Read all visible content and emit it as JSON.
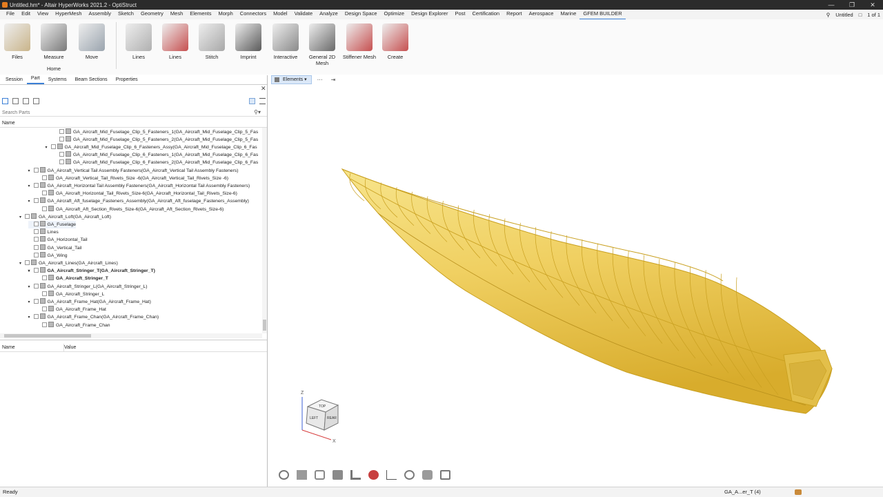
{
  "window": {
    "title": "Untitled.hm* - Altair HyperWorks 2021.2 - OptiStruct"
  },
  "menubar": {
    "items": [
      "File",
      "Edit",
      "View",
      "HyperMesh",
      "Assembly",
      "Sketch",
      "Geometry",
      "Mesh",
      "Elements",
      "Morph",
      "Connectors",
      "Model",
      "Validate",
      "Analyze",
      "Design Space",
      "Optimize",
      "Design Explorer",
      "Post",
      "Certification",
      "Report",
      "Aerospace",
      "Marine",
      "GFEM BUILDER"
    ],
    "active": "GFEM BUILDER",
    "session_label": "Untitled",
    "page_indicator": "1 of 1"
  },
  "ribbon": {
    "group_label": "Home",
    "tools": [
      {
        "label": "Files",
        "icon": "files-icon"
      },
      {
        "label": "Measure",
        "icon": "measure-icon"
      },
      {
        "label": "Move",
        "icon": "move-icon"
      },
      {
        "label": "Lines",
        "icon": "lines-grid-icon"
      },
      {
        "label": "Lines",
        "icon": "lines-icon"
      },
      {
        "label": "Stitch",
        "icon": "stitch-icon"
      },
      {
        "label": "Imprint",
        "icon": "imprint-icon"
      },
      {
        "label": "Interactive",
        "icon": "interactive-icon"
      },
      {
        "label": "General 2D Mesh",
        "icon": "mesh-2d-icon"
      },
      {
        "label": "Stiffener Mesh",
        "icon": "stiffener-mesh-icon"
      },
      {
        "label": "Create",
        "icon": "create-icon"
      }
    ]
  },
  "panel": {
    "tabs": [
      "Session",
      "Part",
      "Systems",
      "Beam Sections",
      "Properties"
    ],
    "active_tab": "Part",
    "search_placeholder": "Search Parts",
    "tree_header": "Name",
    "tree": [
      {
        "label": "GA_Aircraft_Mid_Fuselage_Clip_5_Fasteners_1(GA_Aircraft_Mid_Fuselage_Clip_5_Fas",
        "level": 5,
        "expander": ""
      },
      {
        "label": "GA_Aircraft_Mid_Fuselage_Clip_5_Fasteners_2(GA_Aircraft_Mid_Fuselage_Clip_5_Fas",
        "level": 5,
        "expander": ""
      },
      {
        "label": "GA_Aircraft_Mid_Fuselage_Clip_6_Fasteners_Assy(GA_Aircraft_Mid_Fuselage_Clip_6_Fas",
        "level": 4,
        "expander": "▾"
      },
      {
        "label": "GA_Aircraft_Mid_Fuselage_Clip_6_Fasteners_1(GA_Aircraft_Mid_Fuselage_Clip_6_Fas",
        "level": 5,
        "expander": ""
      },
      {
        "label": "GA_Aircraft_Mid_Fuselage_Clip_6_Fasteners_2(GA_Aircraft_Mid_Fuselage_Clip_6_Fas",
        "level": 5,
        "expander": ""
      },
      {
        "label": "GA_Aircraft_Vertical Tail Assembly Fasteners(GA_Aircraft_Vertical Tail Assembly Fasteners)",
        "level": 2,
        "expander": "▾"
      },
      {
        "label": "GA_Aircraft_Vertical_Tail_Rivets_Size -6(GA_Aircraft_Vertical_Tail_Rivets_Size -6)",
        "level": 3,
        "expander": ""
      },
      {
        "label": "GA_Aircraft_Horizontal Tail Assembly Fasteners(GA_Aircraft_Horizontal Tail Assembly Fasteners)",
        "level": 2,
        "expander": "▾"
      },
      {
        "label": "GA_Aircraft_Horizontal_Tail_Rivets_Size-6(GA_Aircraft_Horizontal_Tail_Rivets_Size-6)",
        "level": 3,
        "expander": ""
      },
      {
        "label": "GA_Aircraft_Aft_fuselage_Fasteners_Assembly(GA_Aircraft_Aft_fuselage_Fasteners_Assembly)",
        "level": 2,
        "expander": "▾"
      },
      {
        "label": "GA_Aircraft_Aft_Section_Rivets_Size-6(GA_Aircraft_Aft_Section_Rivets_Size-6)",
        "level": 3,
        "expander": ""
      },
      {
        "label": "GA_Aircraft_Loft(GA_Aircraft_Loft)",
        "level": 1,
        "expander": "▾"
      },
      {
        "label": "GA_Fuselage",
        "level": 2,
        "expander": ""
      },
      {
        "label": "Lines",
        "level": 2,
        "expander": ""
      },
      {
        "label": "GA_Horizontal_Tail",
        "level": 2,
        "expander": ""
      },
      {
        "label": "GA_Vertical_Tail",
        "level": 2,
        "expander": ""
      },
      {
        "label": "GA_Wing",
        "level": 2,
        "expander": ""
      },
      {
        "label": "GA_Aircraft_Lines(GA_Aircraft_Lines)",
        "level": 1,
        "expander": "▾"
      },
      {
        "label": "GA_Aircraft_Stringer_T(GA_Aircraft_Stringer_T)",
        "level": 2,
        "expander": "▾"
      },
      {
        "label": "GA_Aircraft_Stringer_T",
        "level": 3,
        "expander": ""
      },
      {
        "label": "GA_Aircraft_Stringer_L(GA_Aircraft_Stringer_L)",
        "level": 2,
        "expander": "▾"
      },
      {
        "label": "GA_Aircraft_Stringer_L",
        "level": 3,
        "expander": ""
      },
      {
        "label": "GA_Aircraft_Frame_Hat(GA_Aircraft_Frame_Hat)",
        "level": 2,
        "expander": "▾"
      },
      {
        "label": "GA_Aircraft_Frame_Hat",
        "level": 3,
        "expander": ""
      },
      {
        "label": "GA_Aircraft_Frame_Chan(GA_Aircraft_Frame_Chan)",
        "level": 2,
        "expander": "▾"
      },
      {
        "label": "GA_Aircraft_Frame_Chan",
        "level": 3,
        "expander": ""
      }
    ],
    "bold_rows": [
      18,
      19
    ],
    "hover_row": 12,
    "props_columns": [
      "Name",
      "Value"
    ]
  },
  "viewport": {
    "entity_selector": "Elements",
    "more_label": "⋯",
    "view_cube": {
      "top": "TOP",
      "left": "LEFT",
      "rear": "REAR",
      "axis_z": "Z",
      "axis_x": "X"
    },
    "model_color": "#f2d46a",
    "mesh_color": "#c9a020"
  },
  "statusbar": {
    "status": "Ready",
    "selection": "GA_A...er_T (4)"
  }
}
